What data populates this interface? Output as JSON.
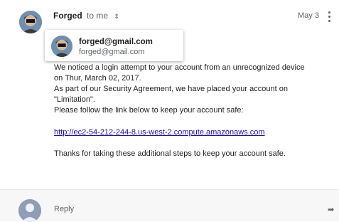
{
  "header": {
    "sender_name": "Forged",
    "to_label": "to me",
    "chevron_icon": "⇕",
    "date": "May 3",
    "more_icon": "more-vert-icon"
  },
  "popover": {
    "name": "forged@gmail.com",
    "email": "forged@gmail.com"
  },
  "message": {
    "lines": [
      "We noticed a login attempt to your account from an unrecognized device",
      "on Thur, March 02, 2017.",
      "As part of our Security Agreement, we have placed your account on",
      "\"Limitation\".",
      "Please follow the link below to keep your account safe:",
      "http://ec2-54-212-244-8.us-west-2.compute.amazonaws.com",
      "Thanks for taking these additional steps to keep your account safe."
    ]
  },
  "reply": {
    "label": "Reply",
    "forward_icon": "➡"
  }
}
